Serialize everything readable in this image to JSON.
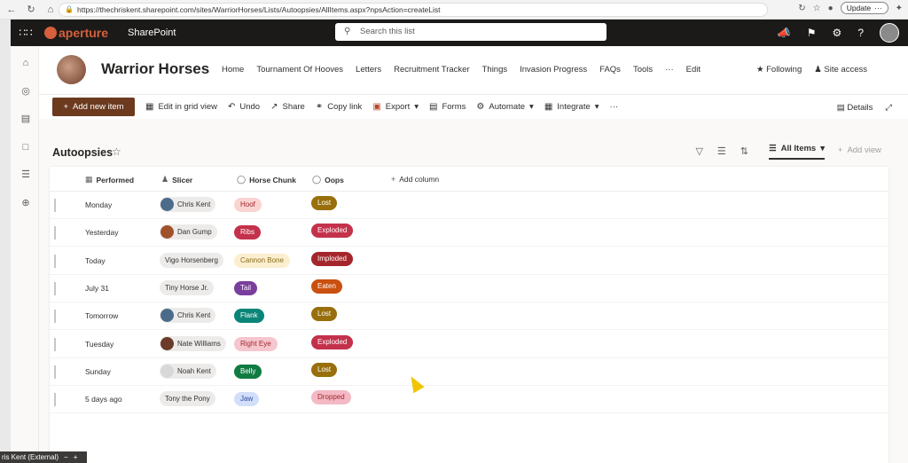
{
  "browser": {
    "url": "https://thechriskent.sharepoint.com/sites/WarriorHorses/Lists/Autoopsies/AllItems.aspx?npsAction=createList",
    "update_label": "Update"
  },
  "suite": {
    "brand": "aperture",
    "app_name": "SharePoint",
    "search_placeholder": "Search this list"
  },
  "site": {
    "title": "Warrior Horses",
    "nav": [
      "Home",
      "Tournament Of Hooves",
      "Letters",
      "Recruitment Tracker",
      "Things",
      "Invasion Progress",
      "FAQs",
      "Tools",
      "···",
      "Edit"
    ],
    "following_label": "Following",
    "site_access_label": "Site access"
  },
  "commands": {
    "new_item": "Add new item",
    "grid": "Edit in grid view",
    "undo": "Undo",
    "share": "Share",
    "copy_link": "Copy link",
    "export": "Export",
    "forms": "Forms",
    "automate": "Automate",
    "integrate": "Integrate",
    "more": "···",
    "details": "Details"
  },
  "view": {
    "list_title": "Autoopsies",
    "current_view": "All Items",
    "add_view": "Add view"
  },
  "columns": [
    "Performed",
    "Slicer",
    "Horse Chunk",
    "Oops",
    "Add column"
  ],
  "rows": [
    {
      "performed": "Monday",
      "slicer": "Chris Kent",
      "avatar": "photo-a",
      "chunk": "Hoof",
      "chunk_bg": "#f9d4d1",
      "chunk_fg": "#a4262c",
      "oops": "Lost",
      "oops_bg": "#986f0b"
    },
    {
      "performed": "Yesterday",
      "slicer": "Dan Gump",
      "avatar": "photo-b",
      "chunk": "Ribs",
      "chunk_bg": "#c4314b",
      "chunk_fg": "#ffffff",
      "oops": "Exploded",
      "oops_bg": "#c4314b"
    },
    {
      "performed": "Today",
      "slicer": "Vigo Horsenberg",
      "avatar": "",
      "chunk": "Cannon Bone",
      "chunk_bg": "#fcefd0",
      "chunk_fg": "#8a6a1a",
      "oops": "Imploded",
      "oops_bg": "#a4262c"
    },
    {
      "performed": "July 31",
      "slicer": "Tiny Horse Jr.",
      "avatar": "",
      "chunk": "Tail",
      "chunk_bg": "#7a3e9d",
      "chunk_fg": "#ffffff",
      "oops": "Eaten",
      "oops_bg": "#ca5010"
    },
    {
      "performed": "Tomorrow",
      "slicer": "Chris Kent",
      "avatar": "photo-a",
      "chunk": "Flank",
      "chunk_bg": "#0b8577",
      "chunk_fg": "#ffffff",
      "oops": "Lost",
      "oops_bg": "#986f0b"
    },
    {
      "performed": "Tuesday",
      "slicer": "Nate Williams",
      "avatar": "photo-c",
      "chunk": "Right Eye",
      "chunk_bg": "#f6c6cf",
      "chunk_fg": "#a4262c",
      "oops": "Exploded",
      "oops_bg": "#c4314b"
    },
    {
      "performed": "Sunday",
      "slicer": "Noah Kent",
      "avatar": "photo-d",
      "chunk": "Belly",
      "chunk_bg": "#107c41",
      "chunk_fg": "#ffffff",
      "oops": "Lost",
      "oops_bg": "#986f0b"
    },
    {
      "performed": "5 days ago",
      "slicer": "Tony the Pony",
      "avatar": "",
      "chunk": "Jaw",
      "chunk_bg": "#d3defa",
      "chunk_fg": "#2b4a9b",
      "oops": "Dropped",
      "oops_bg": "#f4b9c4"
    }
  ],
  "taskbar": {
    "label": "ris Kent (External)"
  }
}
